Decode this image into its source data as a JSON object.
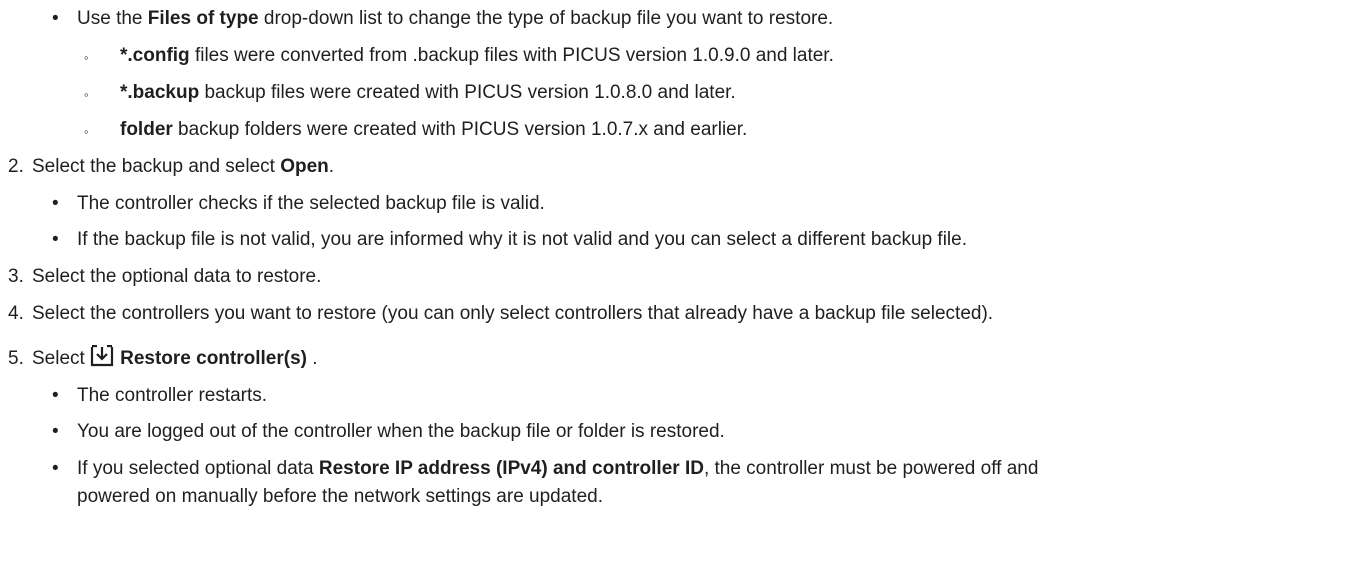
{
  "files_of_type": {
    "pre": "Use the ",
    "bold": "Files of type",
    "post": " drop-down list to change the type of backup file you want to restore.",
    "items": [
      {
        "bold": "*.config",
        "text": " files were converted from .backup files with PICUS version 1.0.9.0 and later."
      },
      {
        "bold": "*.backup",
        "text": " backup files were created with PICUS version 1.0.8.0 and later."
      },
      {
        "bold": "folder",
        "text": " backup folders were created with PICUS version 1.0.7.x and earlier."
      }
    ]
  },
  "steps": [
    {
      "num": "2.",
      "pre": "Select the backup and select ",
      "bold": "Open",
      "post": ".",
      "bullets": [
        "The controller checks if the selected backup file is valid.",
        "If the backup file is not valid, you are informed why it is not valid and you can select a different backup file."
      ]
    },
    {
      "num": "3.",
      "text": "Select the optional data to restore."
    },
    {
      "num": "4.",
      "text": "Select the controllers you want to restore (you can only select controllers that already have a backup file selected)."
    },
    {
      "num": "5.",
      "pre": "Select ",
      "icon": "restore-download-icon",
      "bold": "Restore controller(s)",
      "post": " .",
      "bullets": [
        "The controller restarts.",
        "You are logged out of the controller when the backup file or folder is restored."
      ],
      "last_bullet": {
        "pre": "If you selected optional data ",
        "bold": "Restore IP address (IPv4) and controller ID",
        "post": ", the controller must be powered off and",
        "line2": "powered on manually before the network settings are updated."
      }
    }
  ]
}
